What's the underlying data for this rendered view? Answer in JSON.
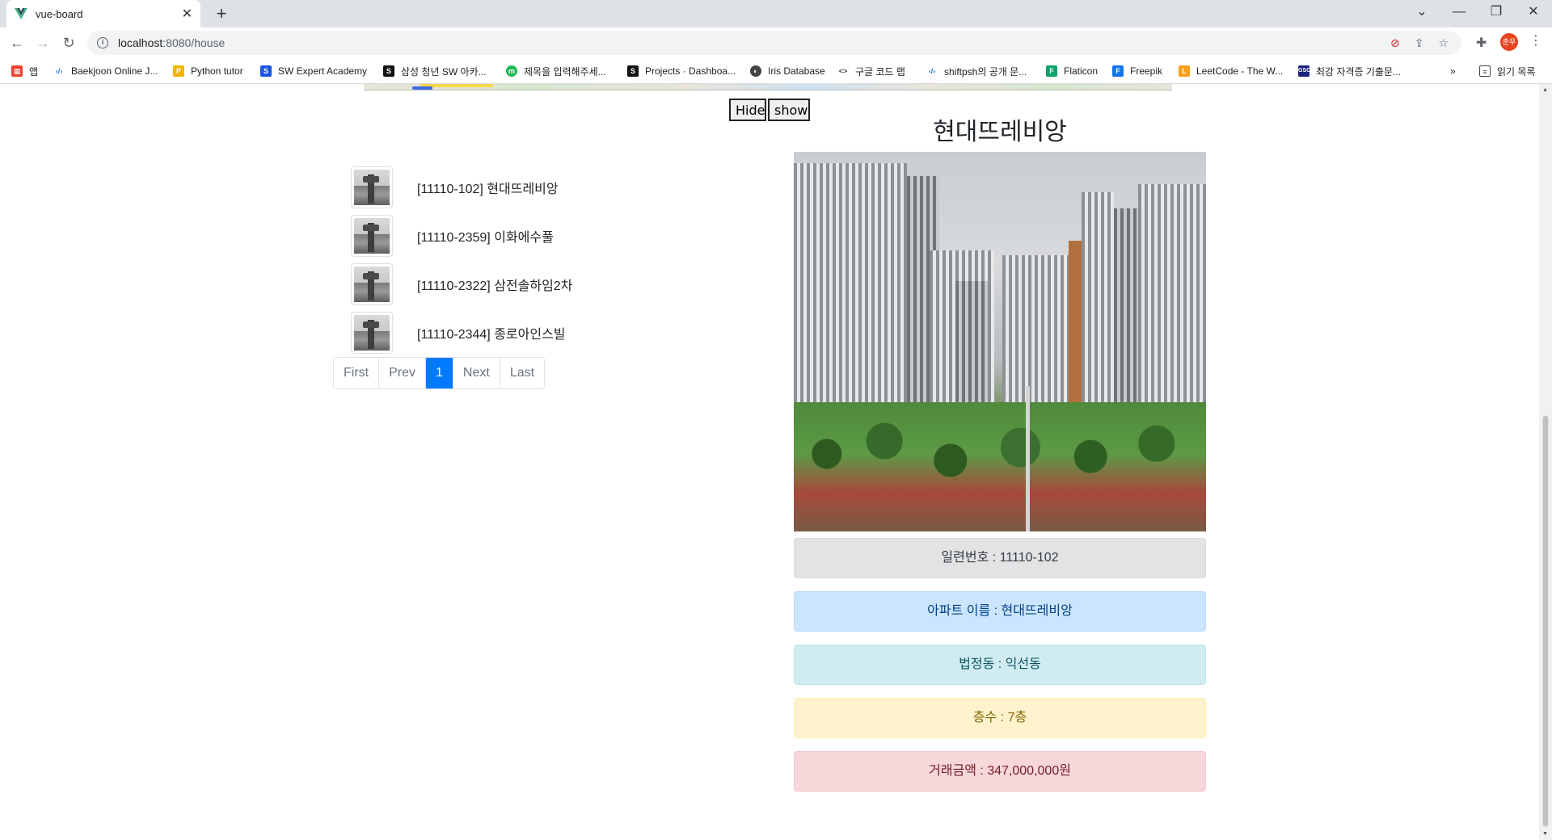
{
  "browser": {
    "tab_title": "vue-board",
    "url_host": "localhost",
    "url_path": ":8080/house",
    "bookmarks": [
      {
        "label": "앱",
        "icon": "apps-grid-icon",
        "color": "#ea4335"
      },
      {
        "label": "Baekjoon Online J...",
        "icon": "code-icon",
        "color": "#1a73e8"
      },
      {
        "label": "Python tutor",
        "icon": "python-icon",
        "color": "#f4b400"
      },
      {
        "label": "SW Expert Academy",
        "icon": "swea-icon",
        "color": "#1a56db"
      },
      {
        "label": "삼성 청년 SW 아카...",
        "icon": "ssafy-icon",
        "color": "#111111"
      },
      {
        "label": "제목을 입력해주세...",
        "icon": "m-icon",
        "color": "#1db954"
      },
      {
        "label": "Projects · Dashboa...",
        "icon": "gitlab-icon",
        "color": "#111111"
      },
      {
        "label": "Iris Database",
        "icon": "globe-icon",
        "color": "#444444"
      },
      {
        "label": "구글 코드 랩",
        "icon": "codelab-icon",
        "color": "#444444"
      },
      {
        "label": "shiftpsh의 공개 문...",
        "icon": "code-icon",
        "color": "#1a73e8"
      },
      {
        "label": "Flaticon",
        "icon": "flaticon-icon",
        "color": "#0aa36b"
      },
      {
        "label": "Freepik",
        "icon": "freepik-icon",
        "color": "#1273eb"
      },
      {
        "label": "LeetCode - The W...",
        "icon": "leetcode-icon",
        "color": "#f89f1b"
      },
      {
        "label": "최강 자격증 기출문...",
        "icon": "gsc-icon",
        "color": "#1a237e"
      }
    ],
    "reading_list": "읽기 목록"
  },
  "map_controls": {
    "hide_label": "Hide",
    "show_label": "show"
  },
  "house_list": [
    {
      "label": "[11110-102] 현대뜨레비앙"
    },
    {
      "label": "[11110-2359] 이화에수풀"
    },
    {
      "label": "[11110-2322] 삼전솔하임2차"
    },
    {
      "label": "[11110-2344] 종로아인스빌"
    }
  ],
  "pagination": {
    "first": "First",
    "prev": "Prev",
    "current": "1",
    "next": "Next",
    "last": "Last"
  },
  "detail": {
    "title": "현대뜨레비앙",
    "serial": "일련번호 : 11110-102",
    "apt_name": "아파트 이름 : 현대뜨레비앙",
    "dong": "법정동 : 익선동",
    "floor": "층수 : 7층",
    "price": "거래금액 : 347,000,000원"
  }
}
